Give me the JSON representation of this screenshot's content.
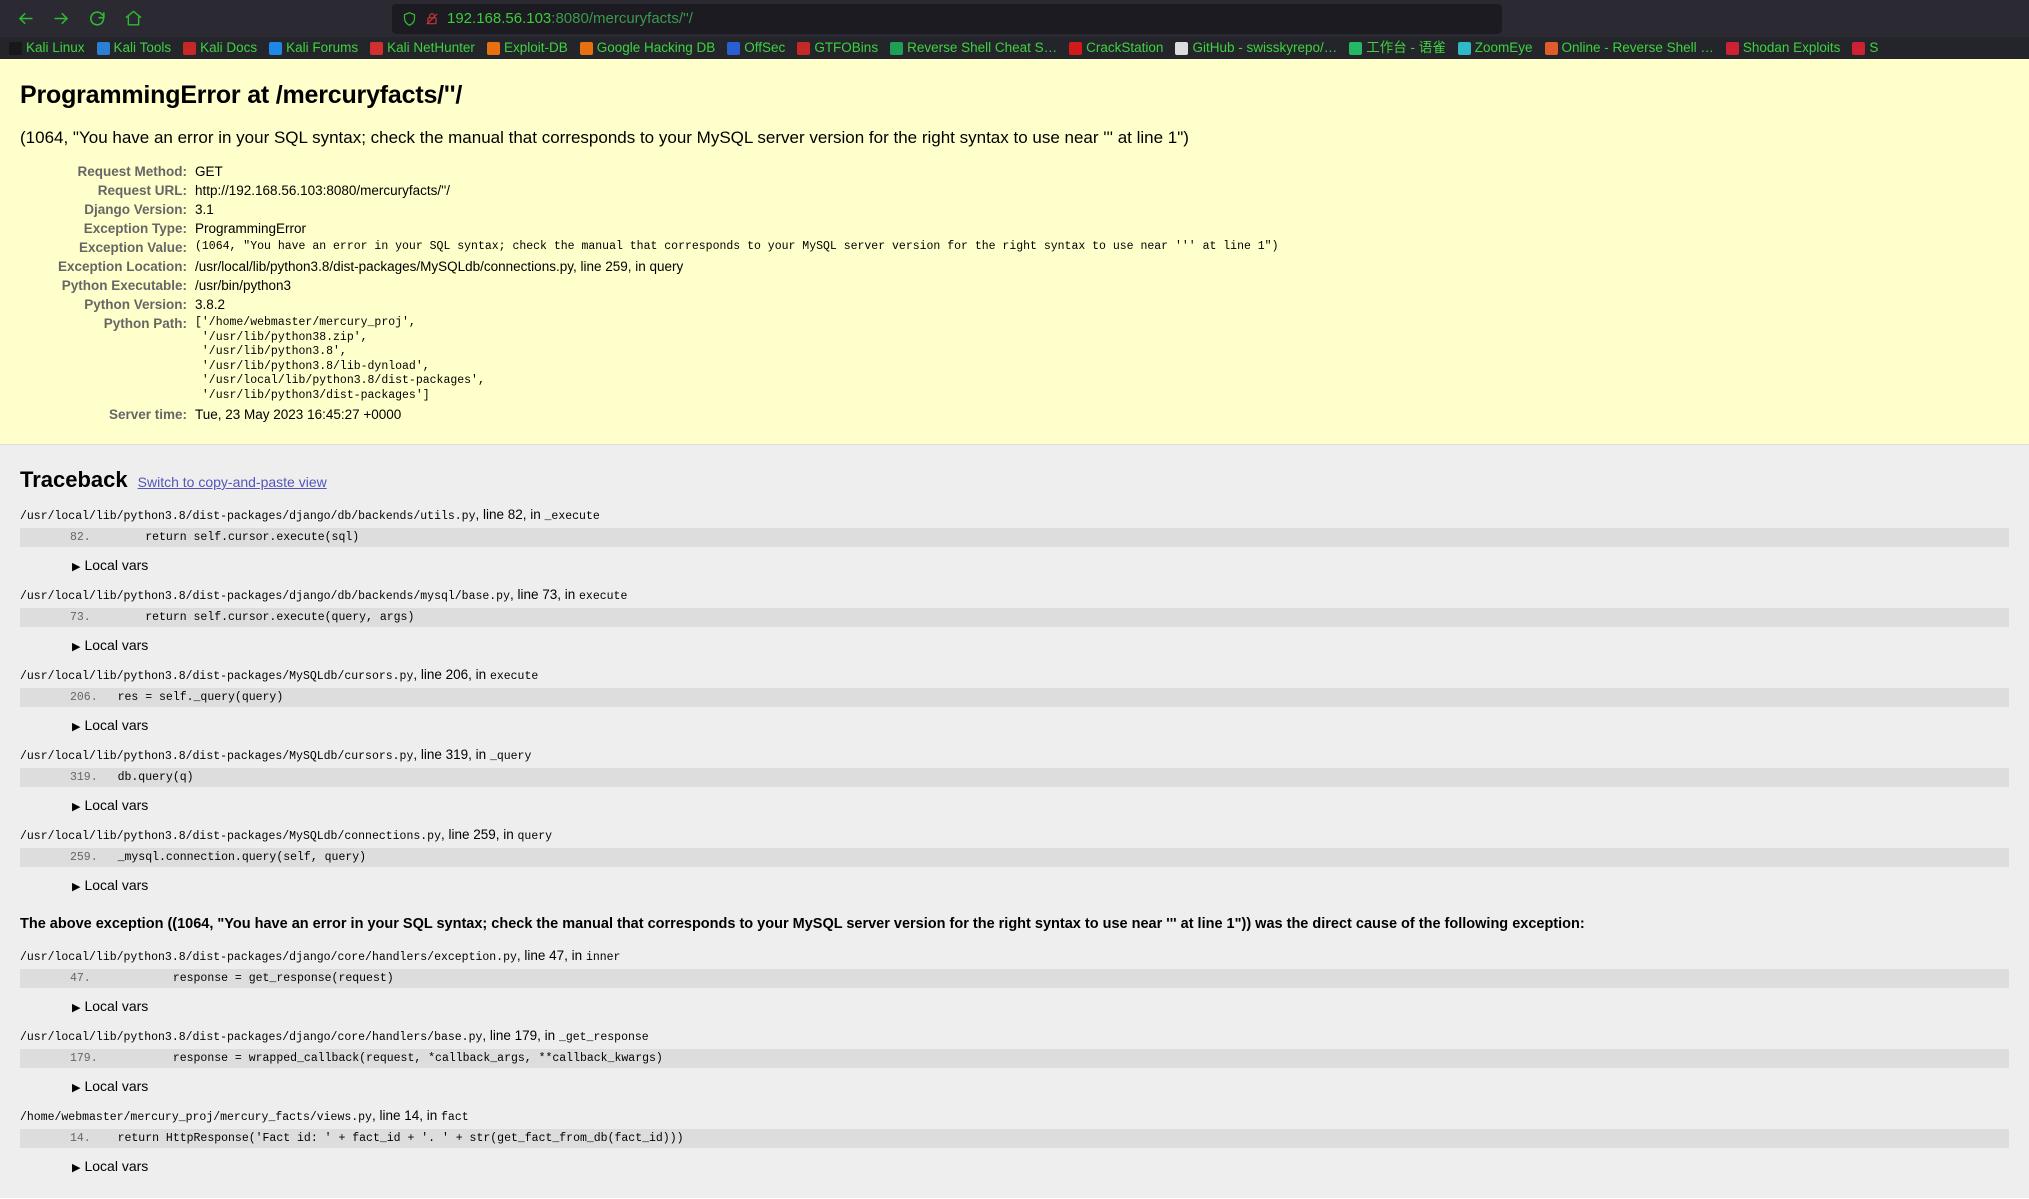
{
  "browser": {
    "nav": {
      "back_label": "Back",
      "forward_label": "Forward",
      "reload_label": "Reload",
      "home_label": "Home"
    },
    "url": {
      "host": "192.168.56.103",
      "rest": ":8080/mercuryfacts/''/",
      "full": "192.168.56.103:8080/mercuryfacts/''/"
    },
    "bookmarks": [
      {
        "label": "Kali Linux",
        "icon": "kali-dragon-icon",
        "color": "#18181b"
      },
      {
        "label": "Kali Tools",
        "icon": "kali-tools-icon",
        "color": "#2a7fd4"
      },
      {
        "label": "Kali Docs",
        "icon": "kali-docs-icon",
        "color": "#c62828"
      },
      {
        "label": "Kali Forums",
        "icon": "kali-forums-icon",
        "color": "#1e88e5"
      },
      {
        "label": "Kali NetHunter",
        "icon": "kali-nethunter-icon",
        "color": "#d32f2f"
      },
      {
        "label": "Exploit-DB",
        "icon": "exploitdb-icon",
        "color": "#e8700f"
      },
      {
        "label": "Google Hacking DB",
        "icon": "google-hacking-db-icon",
        "color": "#e8700f"
      },
      {
        "label": "OffSec",
        "icon": "offsec-icon",
        "color": "#2a5fd4"
      },
      {
        "label": "GTFOBins",
        "icon": "gtfobins-icon",
        "color": "#c62828"
      },
      {
        "label": "Reverse Shell Cheat S…",
        "icon": "reverse-shell-icon",
        "color": "#1f9e55"
      },
      {
        "label": "CrackStation",
        "icon": "crackstation-icon",
        "color": "#d21a1a"
      },
      {
        "label": "GitHub - swisskyrepo/…",
        "icon": "github-icon",
        "color": "#dddddd"
      },
      {
        "label": "工作台 - 语雀",
        "icon": "yuque-icon",
        "color": "#25b864"
      },
      {
        "label": "ZoomEye",
        "icon": "zoomeye-icon",
        "color": "#2fb8c8"
      },
      {
        "label": "Online - Reverse Shell …",
        "icon": "online-reverse-shell-icon",
        "color": "#e05c2a"
      },
      {
        "label": "Shodan Exploits",
        "icon": "shodan-icon",
        "color": "#cc2233"
      },
      {
        "label": "S",
        "icon": "more-bookmarks-icon",
        "color": "#cc2233"
      }
    ]
  },
  "summary": {
    "title": "ProgrammingError at /mercuryfacts/''/",
    "exception_value": "(1064, \"You have an error in your SQL syntax; check the manual that corresponds to your MySQL server version for the right syntax to use near ''' at line 1\")",
    "rows": [
      {
        "label": "Request Method:",
        "value": "GET"
      },
      {
        "label": "Request URL:",
        "value": "http://192.168.56.103:8080/mercuryfacts/''/"
      },
      {
        "label": "Django Version:",
        "value": "3.1"
      },
      {
        "label": "Exception Type:",
        "value": "ProgrammingError"
      },
      {
        "label": "Exception Value:",
        "value": "(1064, \"You have an error in your SQL syntax; check the manual that corresponds to your MySQL server version for the right syntax to use near ''' at line 1\")",
        "mono": true
      },
      {
        "label": "Exception Location:",
        "value": "/usr/local/lib/python3.8/dist-packages/MySQLdb/connections.py, line 259, in query"
      },
      {
        "label": "Python Executable:",
        "value": "/usr/bin/python3"
      },
      {
        "label": "Python Version:",
        "value": "3.8.2"
      },
      {
        "label": "Python Path:",
        "value": "['/home/webmaster/mercury_proj',\n '/usr/lib/python38.zip',\n '/usr/lib/python3.8',\n '/usr/lib/python3.8/lib-dynload',\n '/usr/local/lib/python3.8/dist-packages',\n '/usr/lib/python3/dist-packages']",
        "mono": true
      },
      {
        "label": "Server time:",
        "value": "Tue, 23 May 2023 16:45:27 +0000"
      }
    ]
  },
  "traceback": {
    "heading": "Traceback",
    "switch_label": "Switch to copy-and-paste view",
    "local_vars_label": "Local vars",
    "frames": [
      {
        "path": "/usr/local/lib/python3.8/dist-packages/django/db/backends/utils.py",
        "line_label": ", line 82, in ",
        "func": "_execute",
        "lineno": "82.",
        "code": "        return self.cursor.execute(sql)"
      },
      {
        "path": "/usr/local/lib/python3.8/dist-packages/django/db/backends/mysql/base.py",
        "line_label": ", line 73, in ",
        "func": "execute",
        "lineno": "73.",
        "code": "        return self.cursor.execute(query, args)"
      },
      {
        "path": "/usr/local/lib/python3.8/dist-packages/MySQLdb/cursors.py",
        "line_label": ", line 206, in ",
        "func": "execute",
        "lineno": "206.",
        "code": "    res = self._query(query)"
      },
      {
        "path": "/usr/local/lib/python3.8/dist-packages/MySQLdb/cursors.py",
        "line_label": ", line 319, in ",
        "func": "_query",
        "lineno": "319.",
        "code": "    db.query(q)"
      },
      {
        "path": "/usr/local/lib/python3.8/dist-packages/MySQLdb/connections.py",
        "line_label": ", line 259, in ",
        "func": "query",
        "lineno": "259.",
        "code": "    _mysql.connection.query(self, query)"
      }
    ],
    "cause_text": "The above exception ((1064, \"You have an error in your SQL syntax; check the manual that corresponds to your MySQL server version for the right syntax to use near ''' at line 1\")) was the direct cause of the following exception:",
    "frames_after": [
      {
        "path": "/usr/local/lib/python3.8/dist-packages/django/core/handlers/exception.py",
        "line_label": ", line 47, in ",
        "func": "inner",
        "lineno": "47.",
        "code": "            response = get_response(request)"
      },
      {
        "path": "/usr/local/lib/python3.8/dist-packages/django/core/handlers/base.py",
        "line_label": ", line 179, in ",
        "func": "_get_response",
        "lineno": "179.",
        "code": "            response = wrapped_callback(request, *callback_args, **callback_kwargs)"
      },
      {
        "path": "/home/webmaster/mercury_proj/mercury_facts/views.py",
        "line_label": ", line 14, in ",
        "func": "fact",
        "lineno": "14.",
        "code": "    return HttpResponse('Fact id: ' + fact_id + '. ' + str(get_fact_from_db(fact_id)))"
      }
    ]
  }
}
